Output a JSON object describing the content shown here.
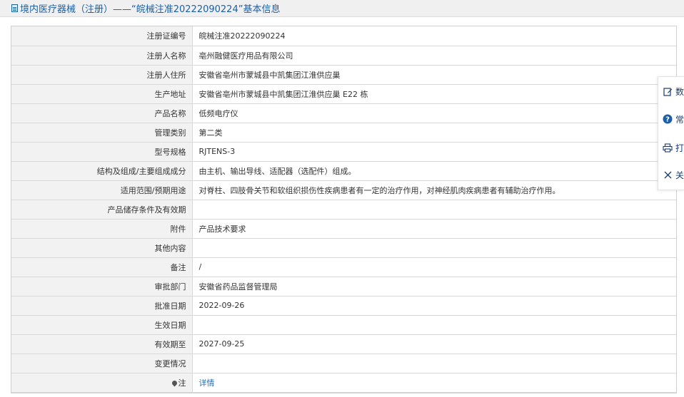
{
  "header": {
    "title": "境内医疗器械（注册）——“皖械注准20222090224”基本信息"
  },
  "rows": [
    {
      "label": "注册证编号",
      "value": "皖械注准20222090224"
    },
    {
      "label": "注册人名称",
      "value": "亳州融健医疗用品有限公司"
    },
    {
      "label": "注册人住所",
      "value": "安徽省亳州市蒙城县中凯集团江淮供应巢"
    },
    {
      "label": "生产地址",
      "value": "安徽省亳州市蒙城县中凯集团江淮供应巢 E22 栋"
    },
    {
      "label": "产品名称",
      "value": "低频电疗仪"
    },
    {
      "label": "管理类别",
      "value": "第二类"
    },
    {
      "label": "型号规格",
      "value": "RJTENS-3"
    },
    {
      "label": "结构及组成/主要组成成分",
      "value": "由主机、输出导线、适配器（选配件）组成。"
    },
    {
      "label": "适用范围/预期用途",
      "value": "对脊柱、四肢骨关节和软组织损伤性疾病患者有一定的治疗作用，对神经肌肉疾病患者有辅助治疗作用。"
    },
    {
      "label": "产品储存条件及有效期",
      "value": ""
    },
    {
      "label": "附件",
      "value": "产品技术要求"
    },
    {
      "label": "其他内容",
      "value": ""
    },
    {
      "label": "备注",
      "value": "/"
    },
    {
      "label": "审批部门",
      "value": "安徽省药品监督管理局"
    },
    {
      "label": "批准日期",
      "value": "2022-09-26"
    },
    {
      "label": "生效日期",
      "value": ""
    },
    {
      "label": "有效期至",
      "value": "2027-09-25"
    },
    {
      "label": "变更情况",
      "value": ""
    },
    {
      "label": "注",
      "value": "详情"
    }
  ],
  "side_panel": {
    "items": [
      {
        "icon": "edit-icon",
        "label": "数"
      },
      {
        "icon": "question-icon",
        "label": "常"
      },
      {
        "icon": "printer-icon",
        "label": "打"
      },
      {
        "icon": "close-icon",
        "label": "关"
      }
    ]
  },
  "colors": {
    "title": "#1c5fa8",
    "link": "#2a6fb7",
    "label_bg": "#f2f2f2"
  }
}
